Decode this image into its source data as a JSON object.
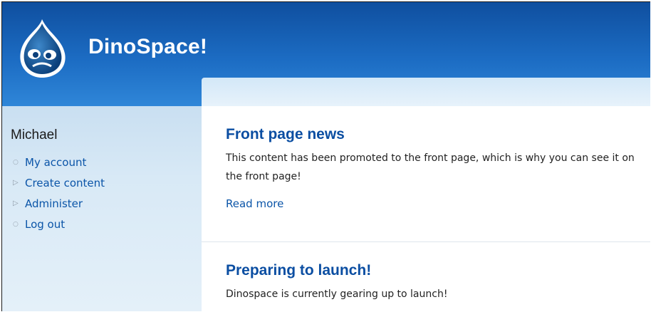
{
  "site": {
    "name": "DinoSpace!"
  },
  "user": {
    "name": "Michael"
  },
  "nav": {
    "items": [
      {
        "label": "My account",
        "bullet": "circle"
      },
      {
        "label": "Create content",
        "bullet": "triangle"
      },
      {
        "label": "Administer",
        "bullet": "triangle"
      },
      {
        "label": "Log out",
        "bullet": "circle"
      }
    ]
  },
  "posts": [
    {
      "title": "Front page news",
      "body": "This content has been promoted to the front page, which is why you can see it on the front page!",
      "read_more": "Read more"
    },
    {
      "title": "Preparing to launch!",
      "body": "Dinospace is currently gearing up to launch!"
    }
  ],
  "colors": {
    "header": "#1c6cc3",
    "link": "#0b55a8",
    "title": "#0b4ea2"
  }
}
